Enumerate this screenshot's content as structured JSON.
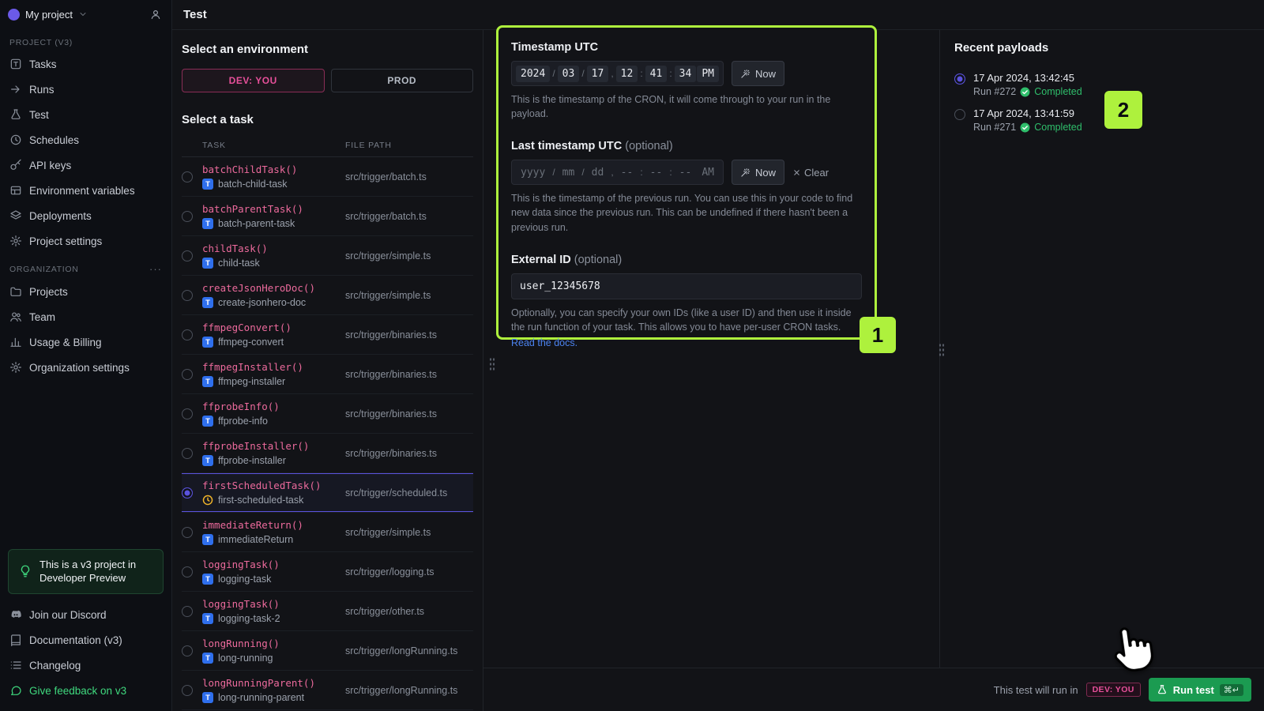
{
  "colors": {
    "accent_lime": "#AEF13D",
    "env_pink": "#E7509A",
    "code_pink": "#EC6A9C",
    "indigo": "#5A52DD",
    "success_green": "#2FBE6B",
    "link_blue": "#4C83F0",
    "run_green": "#1B9B51"
  },
  "sidebar": {
    "project_switcher": {
      "label": "My project"
    },
    "sections": [
      {
        "label": "PROJECT (V3)",
        "items": [
          {
            "label": "Tasks",
            "icon": "tasks"
          },
          {
            "label": "Runs",
            "icon": "runs"
          },
          {
            "label": "Test",
            "icon": "test"
          },
          {
            "label": "Schedules",
            "icon": "clock"
          },
          {
            "label": "API keys",
            "icon": "key"
          },
          {
            "label": "Environment variables",
            "icon": "envvars"
          },
          {
            "label": "Deployments",
            "icon": "layers"
          },
          {
            "label": "Project settings",
            "icon": "gear"
          }
        ]
      },
      {
        "label": "ORGANIZATION",
        "menu": "···",
        "items": [
          {
            "label": "Projects",
            "icon": "folder"
          },
          {
            "label": "Team",
            "icon": "team"
          },
          {
            "label": "Usage & Billing",
            "icon": "chart"
          },
          {
            "label": "Organization settings",
            "icon": "gear"
          }
        ]
      }
    ],
    "preview_banner": "This is a v3 project in Developer Preview",
    "footer_items": [
      {
        "label": "Join our Discord",
        "icon": "discord",
        "accent": false
      },
      {
        "label": "Documentation (v3)",
        "icon": "book",
        "accent": false
      },
      {
        "label": "Changelog",
        "icon": "list",
        "accent": false
      },
      {
        "label": "Give feedback on v3",
        "icon": "chat",
        "accent": true
      }
    ]
  },
  "header": {
    "title": "Test"
  },
  "environment": {
    "heading": "Select an environment",
    "options": [
      {
        "label": "DEV: YOU",
        "selected": true
      },
      {
        "label": "PROD",
        "selected": false
      }
    ]
  },
  "tasks": {
    "heading": "Select a task",
    "columns": [
      "TASK",
      "FILE PATH"
    ],
    "rows": [
      {
        "name": "batchChildTask()",
        "slug": "batch-child-task",
        "path": "src/trigger/batch.ts",
        "badge": "task",
        "selected": false
      },
      {
        "name": "batchParentTask()",
        "slug": "batch-parent-task",
        "path": "src/trigger/batch.ts",
        "badge": "task",
        "selected": false
      },
      {
        "name": "childTask()",
        "slug": "child-task",
        "path": "src/trigger/simple.ts",
        "badge": "task",
        "selected": false
      },
      {
        "name": "createJsonHeroDoc()",
        "slug": "create-jsonhero-doc",
        "path": "src/trigger/simple.ts",
        "badge": "task",
        "selected": false
      },
      {
        "name": "ffmpegConvert()",
        "slug": "ffmpeg-convert",
        "path": "src/trigger/binaries.ts",
        "badge": "task",
        "selected": false
      },
      {
        "name": "ffmpegInstaller()",
        "slug": "ffmpeg-installer",
        "path": "src/trigger/binaries.ts",
        "badge": "task",
        "selected": false
      },
      {
        "name": "ffprobeInfo()",
        "slug": "ffprobe-info",
        "path": "src/trigger/binaries.ts",
        "badge": "task",
        "selected": false
      },
      {
        "name": "ffprobeInstaller()",
        "slug": "ffprobe-installer",
        "path": "src/trigger/binaries.ts",
        "badge": "task",
        "selected": false
      },
      {
        "name": "firstScheduledTask()",
        "slug": "first-scheduled-task",
        "path": "src/trigger/scheduled.ts",
        "badge": "scheduled",
        "selected": true
      },
      {
        "name": "immediateReturn()",
        "slug": "immediateReturn",
        "path": "src/trigger/simple.ts",
        "badge": "task",
        "selected": false
      },
      {
        "name": "loggingTask()",
        "slug": "logging-task",
        "path": "src/trigger/logging.ts",
        "badge": "task",
        "selected": false
      },
      {
        "name": "loggingTask()",
        "slug": "logging-task-2",
        "path": "src/trigger/other.ts",
        "badge": "task",
        "selected": false
      },
      {
        "name": "longRunning()",
        "slug": "long-running",
        "path": "src/trigger/longRunning.ts",
        "badge": "task",
        "selected": false
      },
      {
        "name": "longRunningParent()",
        "slug": "long-running-parent",
        "path": "src/trigger/longRunning.ts",
        "badge": "task",
        "selected": false
      }
    ]
  },
  "form": {
    "timestamp": {
      "label": "Timestamp UTC",
      "values": {
        "year": "2024",
        "month": "03",
        "day": "17",
        "hour": "12",
        "minute": "41",
        "second": "34",
        "meridiem": "PM"
      },
      "now_label": "Now",
      "help": "This is the timestamp of the CRON, it will come through to your run in the payload."
    },
    "last_timestamp": {
      "label": "Last timestamp UTC",
      "optional": "(optional)",
      "placeholders": {
        "year": "yyyy",
        "month": "mm",
        "day": "dd",
        "hour": "--",
        "minute": "--",
        "second": "--",
        "meridiem": "AM"
      },
      "now_label": "Now",
      "clear_label": "Clear",
      "help": "This is the timestamp of the previous run. You can use this in your code to find new data since the previous run. This can be undefined if there hasn't been a previous run."
    },
    "external_id": {
      "label": "External ID",
      "optional": "(optional)",
      "value": "user_12345678",
      "help": "Optionally, you can specify your own IDs (like a user ID) and then use it inside the run function of your task. This allows you to have per-user CRON tasks.",
      "link": "Read the docs."
    }
  },
  "payloads": {
    "heading": "Recent payloads",
    "items": [
      {
        "timestamp": "17 Apr 2024, 13:42:45",
        "run": "Run #272",
        "status": "Completed",
        "selected": true
      },
      {
        "timestamp": "17 Apr 2024, 13:41:59",
        "run": "Run #271",
        "status": "Completed",
        "selected": false
      }
    ]
  },
  "footer_bar": {
    "text": "This test will run in",
    "env_badge": "DEV: YOU",
    "run_button": "Run test",
    "shortcut": "⌘↵"
  },
  "annotations": {
    "form_badge": "1",
    "payload_badge": "2"
  }
}
